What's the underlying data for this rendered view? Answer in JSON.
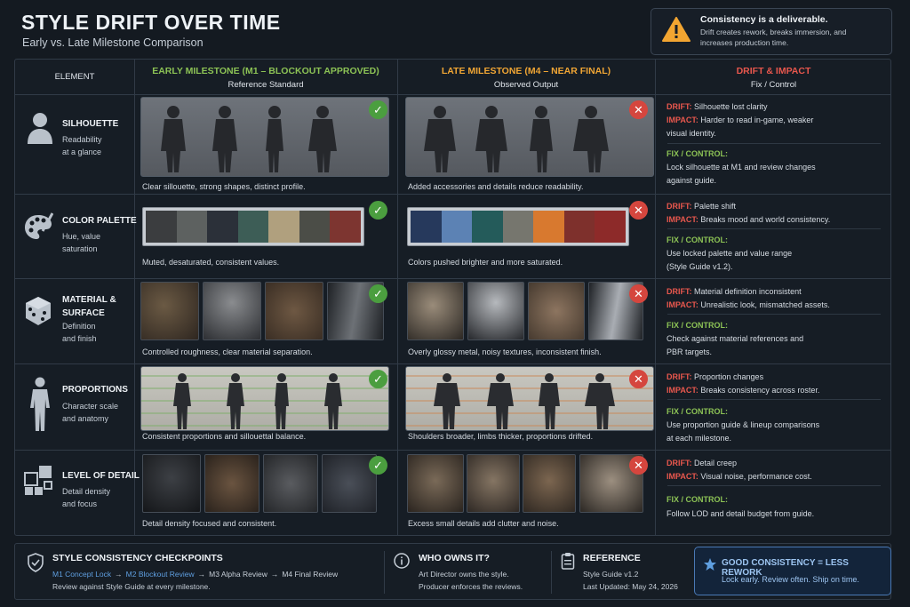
{
  "header": {
    "title": "STYLE DRIFT OVER TIME",
    "subtitle": "Early vs. Late Milestone Comparison"
  },
  "callout": {
    "icon": "warning-icon",
    "title": "Consistency is a deliverable.",
    "line1": "Drift creates rework, breaks immersion, and",
    "line2": "increases production time."
  },
  "columns": {
    "element": "ELEMENT",
    "early": {
      "title": "EARLY MILESTONE (M1 – BLOCKOUT APPROVED)",
      "sub": "Reference Standard"
    },
    "late": {
      "title": "LATE MILESTONE (M4 – NEAR FINAL)",
      "sub": "Observed Output"
    },
    "drift": {
      "title": "DRIFT & IMPACT",
      "sub": "Fix / Control"
    }
  },
  "labels": {
    "drift": "DRIFT:",
    "impact": "IMPACT:",
    "fix": "FIX / CONTROL:"
  },
  "rows": [
    {
      "name": "SILHOUETTE",
      "desc1": "Readability",
      "desc2": "at a glance",
      "early_cap": "Clear sillouette, strong shapes, distinct profile.",
      "late_cap": "Added accessories and details reduce readability.",
      "drift": "Silhouette lost clarity",
      "impact1": "Harder to read in-game, weaker",
      "impact2": "visual identity.",
      "fix1": "Lock silhouette at M1 and review changes",
      "fix2": "against guide."
    },
    {
      "name": "COLOR PALETTE",
      "desc1": "Hue, value",
      "desc2": "saturation",
      "early_cap": "Muted, desaturated, consistent values.",
      "late_cap": "Colors pushed brighter and more saturated.",
      "drift": "Palette shift",
      "impact1": "Breaks mood and world consistency.",
      "impact2": "",
      "fix1": "Use locked palette and value range",
      "fix2": "(Style Guide v1.2).",
      "early_swatches": [
        "#3b3d3f",
        "#5d6160",
        "#2b3039",
        "#3d5d56",
        "#b0a07e",
        "#4b4d47",
        "#7d3530"
      ],
      "late_swatches": [
        "#26395c",
        "#5c82b4",
        "#245b5a",
        "#76766e",
        "#d8792f",
        "#7e302c",
        "#8d2a29"
      ]
    },
    {
      "name1": "MATERIAL &",
      "name2": "SURFACE",
      "desc1": "Definition",
      "desc2": "and finish",
      "early_cap": "Controlled roughness, clear material separation.",
      "late_cap": "Overly glossy metal, noisy textures, inconsistent finish.",
      "drift": "Material definition inconsistent",
      "impact1": "Unrealistic look, mismatched assets.",
      "impact2": "",
      "fix1": "Check against material references and",
      "fix2": "PBR targets."
    },
    {
      "name": "PROPORTIONS",
      "desc1": "Character scale",
      "desc2": "and anatomy",
      "early_cap": "Consistent proportions and sillouettal balance.",
      "late_cap": "Shoulders broader, limbs thicker, proportions drifted.",
      "drift": "Proportion changes",
      "impact1": "Breaks consistency across roster.",
      "impact2": "",
      "fix1": "Use proportion guide & lineup comparisons",
      "fix2": "at each milestone."
    },
    {
      "name": "LEVEL OF DETAIL",
      "desc1": "Detail density",
      "desc2": "and focus",
      "early_cap": "Detail density focused and consistent.",
      "late_cap": "Excess small details add clutter and noise.",
      "drift": "Detail creep",
      "impact1": "Visual noise, performance cost.",
      "impact2": "",
      "fix1": "Follow LOD and detail budget from guide.",
      "fix2": ""
    }
  ],
  "footer": {
    "checkpoints": {
      "title": "STYLE CONSISTENCY CHECKPOINTS",
      "steps": [
        "M1 Concept Lock",
        "M2 Blockout Review",
        "M3 Alpha Review",
        "M4 Final Review"
      ],
      "arrow": "→",
      "note": "Review against Style Guide at every milestone."
    },
    "owner": {
      "title": "WHO OWNS IT?",
      "line1": "Art Director owns the style.",
      "line2": "Producer enforces the reviews."
    },
    "reference": {
      "title": "REFERENCE",
      "line1": "Style Guide v1.2",
      "line2": "Last Updated: May 24, 2026"
    },
    "good": {
      "title": "GOOD CONSISTENCY = LESS REWORK",
      "line": "Lock early. Review often. Ship on time."
    }
  }
}
